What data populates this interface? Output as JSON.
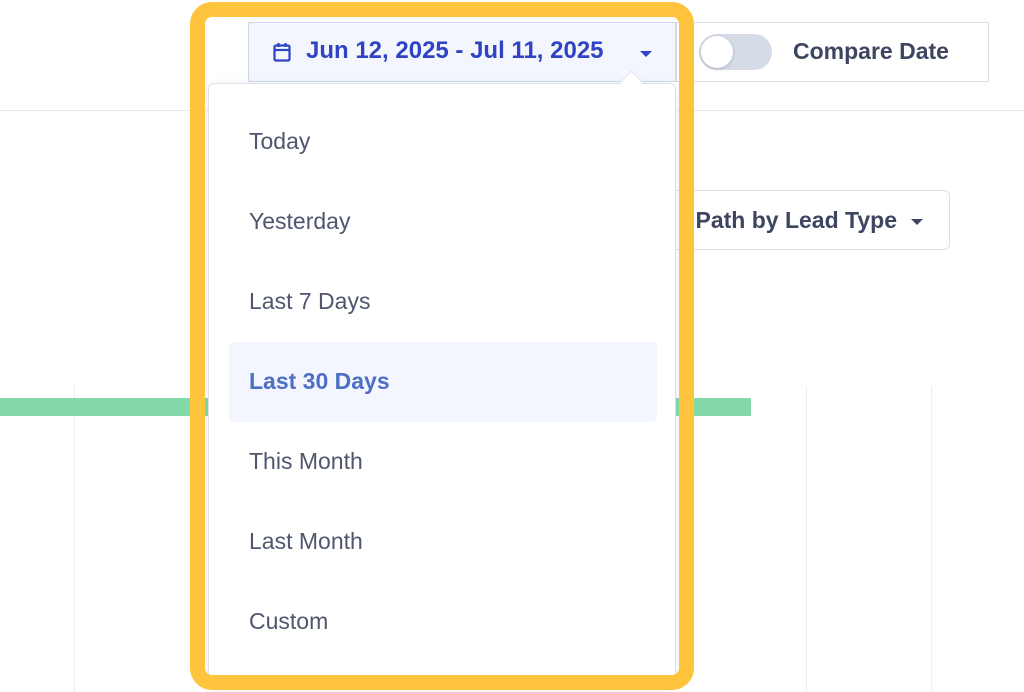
{
  "header": {
    "date_range": {
      "icon": "calendar-icon",
      "label": "Jun 12, 2025 - Jul 11, 2025",
      "color": "#2f43c4"
    },
    "compare": {
      "toggle_on": false,
      "label": "Compare Date"
    }
  },
  "filters": {
    "lead_type_dropdown_label": "Path by Lead Type"
  },
  "date_menu": {
    "items": [
      {
        "label": "Today"
      },
      {
        "label": "Yesterday"
      },
      {
        "label": "Last 7 Days"
      },
      {
        "label": "Last 30 Days"
      },
      {
        "label": "This Month"
      },
      {
        "label": "Last Month"
      },
      {
        "label": "Custom"
      }
    ],
    "selected_item": "Last 30 Days"
  },
  "colors": {
    "highlight": "#ffc43d",
    "chart_bar": "#84d9a8",
    "selected_item_bg": "#f3f6fe",
    "selected_item_text": "#4d6fc4"
  }
}
